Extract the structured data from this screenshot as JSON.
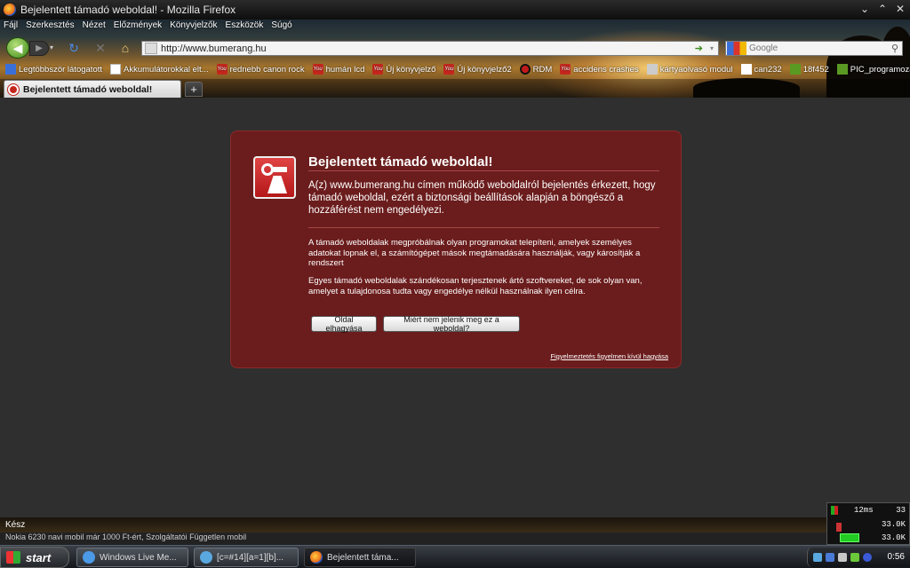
{
  "window": {
    "title": "Bejelentett támadó weboldal! - Mozilla Firefox"
  },
  "menu": [
    "Fájl",
    "Szerkesztés",
    "Nézet",
    "Előzmények",
    "Könyvjelzők",
    "Eszközök",
    "Súgó"
  ],
  "nav": {
    "url": "http://www.bumerang.hu",
    "search_placeholder": "Google"
  },
  "bookmarks": [
    {
      "label": "Legtöbbször látogatott",
      "icon": "blue"
    },
    {
      "label": "Akkumulátorokkal elt...",
      "icon": "page"
    },
    {
      "label": "rednebb canon rock",
      "icon": "yt"
    },
    {
      "label": "humán lcd",
      "icon": "yt"
    },
    {
      "label": "Új könyvjelző",
      "icon": "yt"
    },
    {
      "label": "Új könyvjelző2",
      "icon": "yt"
    },
    {
      "label": "RDM",
      "icon": "rdm"
    },
    {
      "label": "accidens crashes",
      "icon": "yt"
    },
    {
      "label": "kártyaolvasó modul",
      "icon": "card"
    },
    {
      "label": "can232",
      "icon": "doc"
    },
    {
      "label": "18f452",
      "icon": "green"
    },
    {
      "label": "PIC_programozas_",
      "icon": "green"
    }
  ],
  "tab": {
    "label": "Bejelentett támadó weboldal!",
    "new_tab": "+"
  },
  "warning": {
    "title": "Bejelentett támadó weboldal!",
    "main": "A(z) www.bumerang.hu címen működő weboldalról bejelentés érkezett, hogy támadó weboldal, ezért a biztonsági beállítások alapján a böngésző a hozzáférést nem engedélyezi.",
    "p1": "A támadó weboldalak megpróbálnak olyan programokat telepíteni, amelyek személyes adatokat lopnak el, a számítógépet mások megtámadására használják, vagy károsítják a rendszert",
    "p2": "Egyes támadó weboldalak szándékosan terjesztenek ártó szoftvereket, de sok olyan van, amelyet a tulajdonosa tudta vagy engedélye nélkül használnak ilyen célra.",
    "btn_leave": "Oldal elhagyása",
    "btn_why": "Miért nem jelenik meg ez a weboldal?",
    "ignore": "Figyelmeztetés figyelmen kívül hagyása"
  },
  "status": "Kész",
  "strip_text": "Nokia 6230 navi mobil már 1000 Ft-ért, Szolgáltatói Független mobil",
  "meter": {
    "ping": "12ms",
    "count": "33",
    "up": "33.0K",
    "down": "33.0K"
  },
  "taskbar": {
    "start": "start",
    "tasks": [
      "Windows Live Me...",
      "[c=#14][a=1][b]...",
      "Bejelentett táma..."
    ],
    "clock": "0:56"
  }
}
